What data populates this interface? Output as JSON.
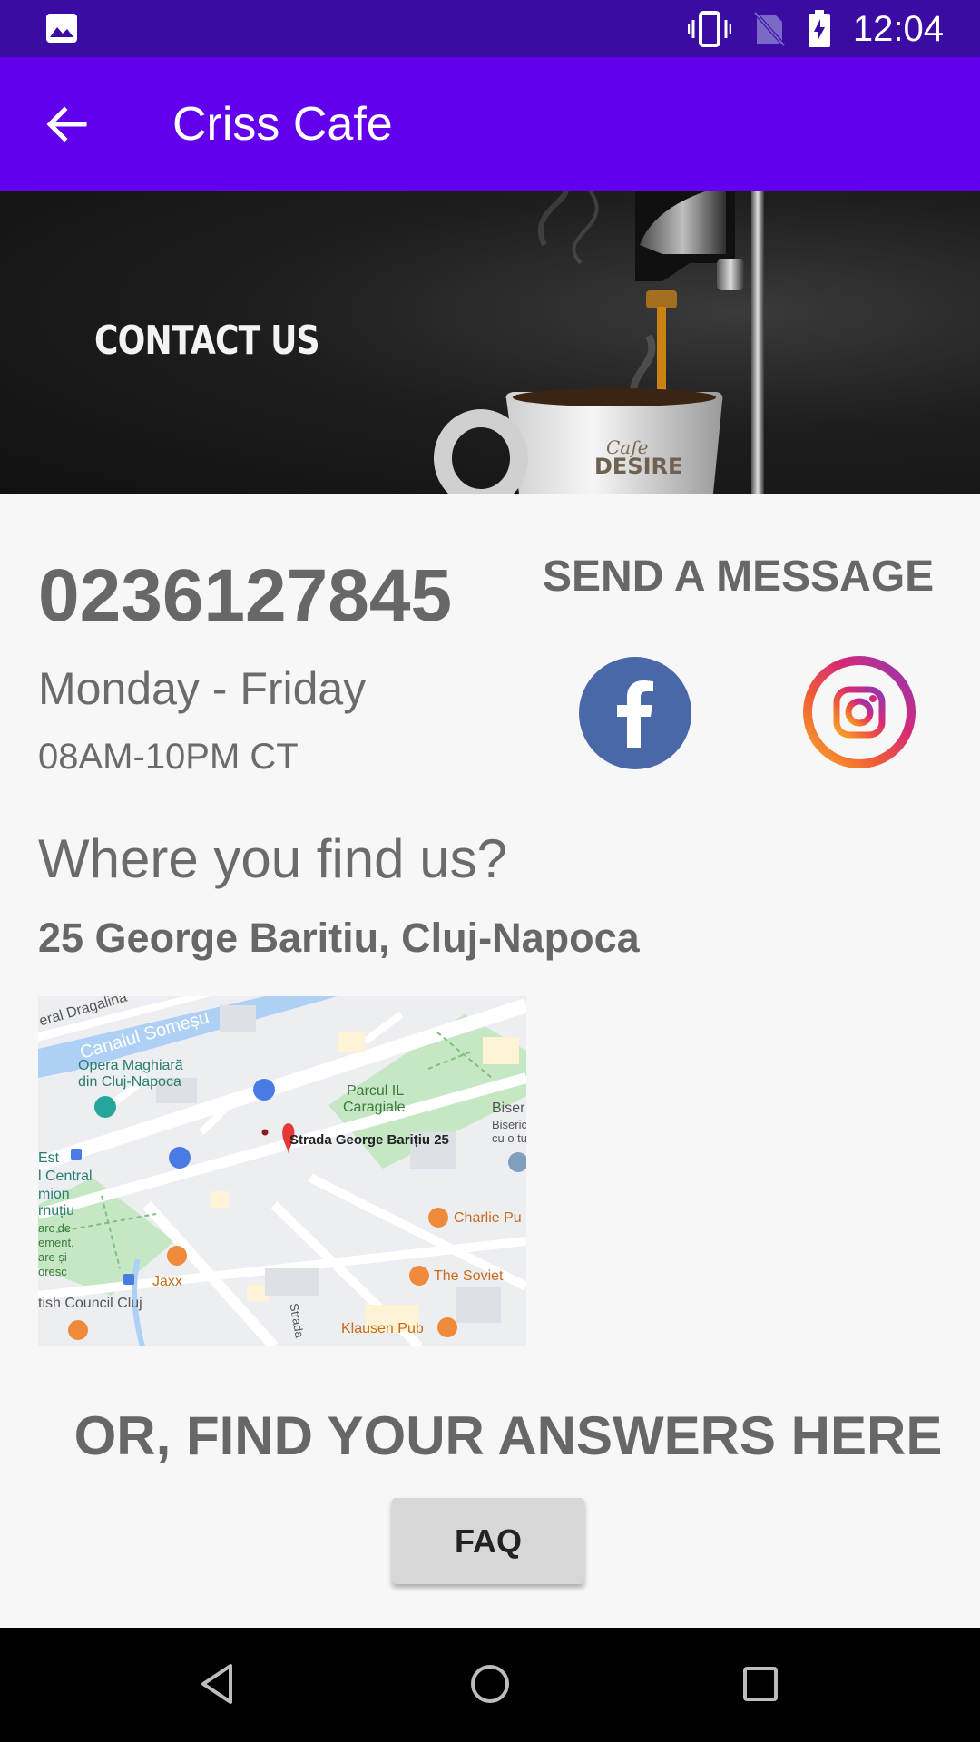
{
  "status_bar": {
    "time": "12:04",
    "icons": [
      "image-icon",
      "vibrate-icon",
      "no-sim-icon",
      "battery-charging-icon"
    ]
  },
  "app_bar": {
    "title": "Criss Cafe",
    "back_icon": "arrow-back-icon"
  },
  "banner": {
    "heading": "CONTACT US",
    "cup_brand": [
      "Cafe",
      "DESIRE"
    ]
  },
  "contact": {
    "phone": "0236127845",
    "days": "Monday - Friday",
    "hours": "08AM-10PM CT",
    "send_message": "SEND A MESSAGE",
    "social": [
      "facebook-icon",
      "instagram-icon"
    ]
  },
  "location": {
    "heading": "Where you find us?",
    "address": "25 George Baritiu, Cluj-Napoca",
    "map_labels": {
      "road_top": "eral Dragalina",
      "canal": "Canalul Someșu",
      "opera_1": "Opera Maghiară",
      "opera_2": "din Cluj-Napoca",
      "park_1": "Parcul IL",
      "park_2": "Caragiale",
      "pin": "Strada George Barițiu 25",
      "biser_1": "Biser",
      "biser_2": "Biseric",
      "biser_3": "cu o tu",
      "est": "Est",
      "central": "l Central",
      "mion": "mion",
      "rnutiu": "rnuțiu",
      "arc_de": "arc de",
      "ement": "ement,",
      "are_si": "are și",
      "oresc": "oresc",
      "charlie": "Charlie Pu",
      "soviet": "The Soviet",
      "jaxx": "Jaxx",
      "british": "tish Council Cluj",
      "klausen": "Klausen Pub",
      "strada": "Strada"
    }
  },
  "faq_section": {
    "heading": "OR, FIND YOUR ANSWERS HERE",
    "button_label": "FAQ"
  },
  "nav_bar": {
    "icons": [
      "nav-back-icon",
      "nav-home-icon",
      "nav-recents-icon"
    ]
  },
  "colors": {
    "status_bar": "#3a0ca3",
    "app_bar": "#6200ee",
    "facebook": "#4a67a8",
    "text_grey": "#676767",
    "faq_button": "#d7d7d7"
  }
}
